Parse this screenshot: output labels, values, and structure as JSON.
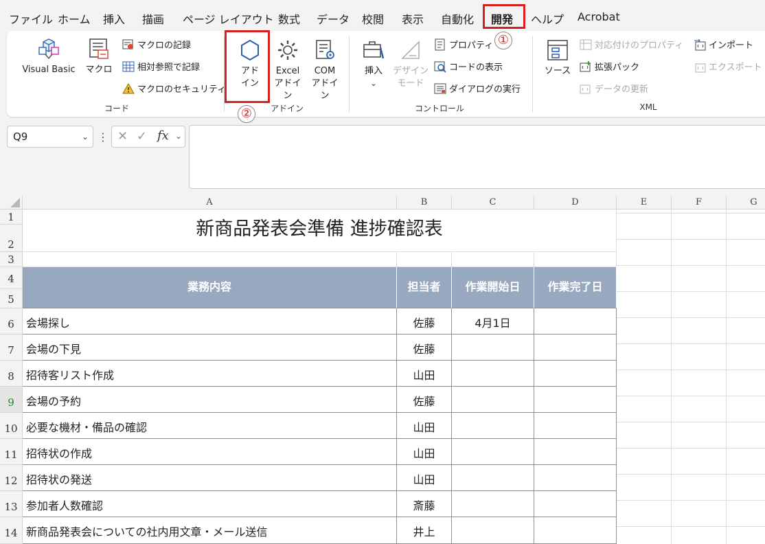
{
  "menu": {
    "tabs": [
      "ファイル",
      "ホーム",
      "挿入",
      "描画",
      "ページ レイアウト",
      "数式",
      "データ",
      "校閲",
      "表示",
      "自動化",
      "開発",
      "ヘルプ",
      "Acrobat"
    ],
    "active": "開発"
  },
  "callouts": {
    "one": "①",
    "two": "②"
  },
  "ribbon": {
    "code": {
      "visual_basic": "Visual Basic",
      "macro": "マクロ",
      "record_macro": "マクロの記録",
      "relative_ref": "相対参照で記録",
      "macro_security": "マクロのセキュリティ",
      "label": "コード"
    },
    "addins": {
      "addin_line1": "アド",
      "addin_line2": "イン",
      "excel_line1": "Excel",
      "excel_line2": "アドイン",
      "com_line1": "COM",
      "com_line2": "アドイン",
      "label": "アドイン"
    },
    "controls": {
      "insert": "挿入",
      "design_line1": "デザイン",
      "design_line2": "モード",
      "properties": "プロパティ",
      "view_code": "コードの表示",
      "run_dialog": "ダイアログの実行",
      "label": "コントロール"
    },
    "xml": {
      "source": "ソース",
      "map_properties": "対応付けのプロパティ",
      "expansion_packs": "拡張パック",
      "refresh_data": "データの更新",
      "import": "インポート",
      "export": "エクスポート",
      "label": "XML"
    }
  },
  "formula_bar": {
    "name_box": "Q9",
    "fx": "fx",
    "formula": ""
  },
  "grid": {
    "columns": [
      "A",
      "B",
      "C",
      "D",
      "E",
      "F",
      "G"
    ],
    "rows": [
      "1",
      "2",
      "3",
      "4",
      "5",
      "6",
      "7",
      "8",
      "9",
      "10",
      "11",
      "12",
      "13",
      "14"
    ],
    "title": "新商品発表会準備 進捗確認表",
    "headers": [
      "業務内容",
      "担当者",
      "作業開始日",
      "作業完了日"
    ],
    "data": [
      [
        "会場探し",
        "佐藤",
        "4月1日",
        ""
      ],
      [
        "会場の下見",
        "佐藤",
        "",
        ""
      ],
      [
        "招待客リスト作成",
        "山田",
        "",
        ""
      ],
      [
        "会場の予約",
        "佐藤",
        "",
        ""
      ],
      [
        "必要な機材・備品の確認",
        "山田",
        "",
        ""
      ],
      [
        "招待状の作成",
        "山田",
        "",
        ""
      ],
      [
        "招待状の発送",
        "山田",
        "",
        ""
      ],
      [
        "参加者人数確認",
        "斎藤",
        "",
        ""
      ],
      [
        "新商品発表会についての社内用文章・メール送信",
        "井上",
        "",
        ""
      ]
    ]
  },
  "colors": {
    "header_fill": "#97a8bf",
    "highlight": "#d61f1f"
  }
}
